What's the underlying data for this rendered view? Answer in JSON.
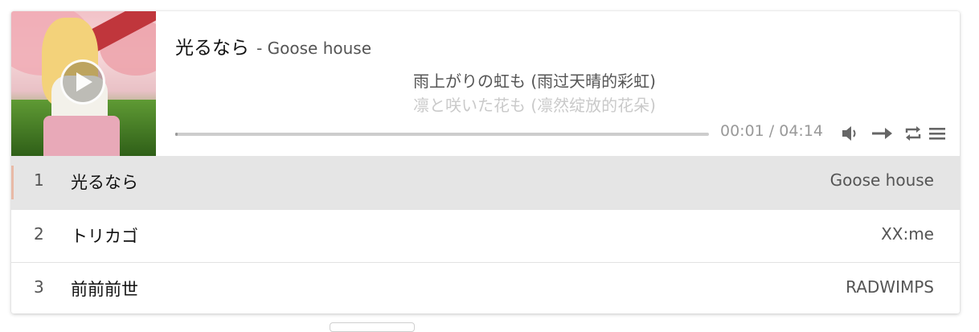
{
  "now_playing": {
    "title": "光るなら",
    "author": "- Goose house",
    "lyric_current": "雨上がりの虹も (雨过天晴的彩虹)",
    "lyric_next": "凛と咲いた花も (凛然绽放的花朵)",
    "time": "00:01 / 04:14",
    "progress_fraction": 0.004
  },
  "icons": {
    "play": "play-icon",
    "volume": "volume-icon",
    "order": "order-arrow-icon",
    "loop": "loop-icon",
    "menu": "menu-icon"
  },
  "colors": {
    "active_row_bg": "#e5e5e5",
    "active_marker": "#e8b9a6",
    "progress_fill": "#999999"
  },
  "playlist": [
    {
      "index": "1",
      "title": "光るなら",
      "artist": "Goose house"
    },
    {
      "index": "2",
      "title": "トリカゴ",
      "artist": "XX:me"
    },
    {
      "index": "3",
      "title": "前前前世",
      "artist": "RADWIMPS"
    }
  ]
}
